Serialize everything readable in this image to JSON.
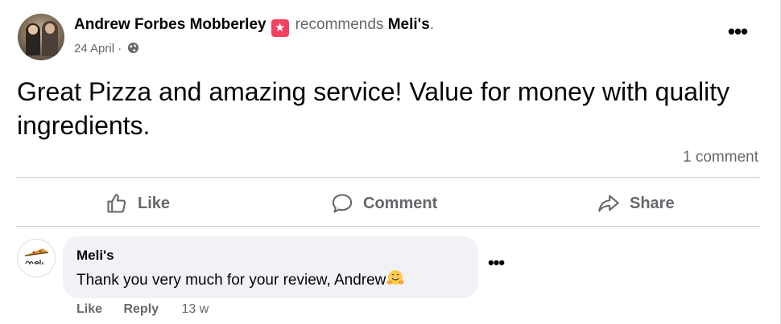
{
  "post": {
    "author": "Andrew Forbes Mobberley",
    "recommend_word": "recommends",
    "page_name": "Meli's",
    "period": ".",
    "date": "24 April",
    "separator": "·",
    "text": "Great Pizza and amazing service! Value for money with quality ingredients.",
    "comment_count": "1 comment",
    "more_label": "•••"
  },
  "actions": {
    "like": "Like",
    "comment": "Comment",
    "share": "Share"
  },
  "comment": {
    "author": "Meli's",
    "text": "Thank you very much for your review, Andrew",
    "like": "Like",
    "reply": "Reply",
    "time": "13 w",
    "more_label": "•••"
  },
  "colors": {
    "accent_recommend": "#f3425f",
    "muted_text": "#65676b",
    "bubble": "#f0f2f5"
  },
  "icons": [
    "recommend-star-icon",
    "globe-icon",
    "more-icon",
    "like-thumb-icon",
    "comment-bubble-icon",
    "share-arrow-icon",
    "hugging-face-emoji"
  ]
}
